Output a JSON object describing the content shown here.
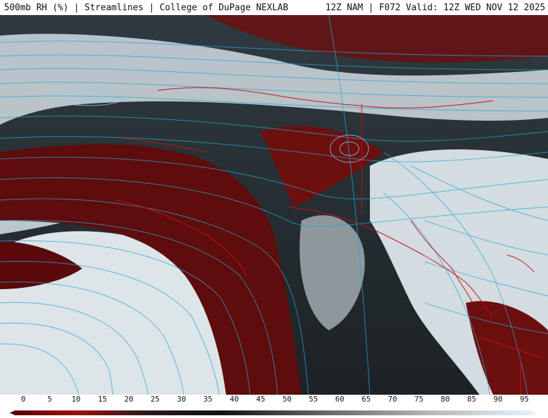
{
  "header": {
    "left_title": "500mb RH (%) | Streamlines | College of DuPage NEXLAB",
    "right_title": "12Z NAM | F072 Valid: 12Z WED NOV 12 2025"
  },
  "scale": {
    "ticks": [
      "0",
      "5",
      "10",
      "15",
      "20",
      "25",
      "30",
      "35",
      "40",
      "45",
      "50",
      "55",
      "60",
      "65",
      "70",
      "75",
      "80",
      "85",
      "90",
      "95"
    ],
    "colors": {
      "dry": "#5a0a0a",
      "mid": "#7a7a7a",
      "moist": "#dfe6ea",
      "streamline": "#2aa6d6",
      "borders": "#cc1111"
    }
  }
}
